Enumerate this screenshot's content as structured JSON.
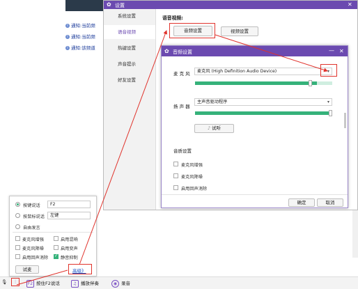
{
  "background": {
    "notices": [
      {
        "prefix": "通知:",
        "text": "当前频"
      },
      {
        "prefix": "通知:",
        "text": "当前频"
      },
      {
        "prefix": "通知:",
        "text": "该频道"
      }
    ]
  },
  "bottom_bar": {
    "hold_f2": "按住F2说话",
    "play_music": "播放伴奏",
    "record": "录音"
  },
  "settings": {
    "title": "设置",
    "sidebar": [
      "系统设置",
      "语音视频",
      "热键设置",
      "声音提示",
      "好友设置"
    ],
    "active_index": 1,
    "section_label": "语音视频:",
    "audio_button": "音频设置",
    "video_button": "视频设置"
  },
  "audio_dialog": {
    "title": "音频设置",
    "mic_label": "麦 克 风",
    "mic_device": "麦克风 (High Definition Audio Device)",
    "mic_level": 0.89,
    "speaker_label": "扬 声 器",
    "speaker_device": "主声音驱动程序",
    "speaker_level": 1.0,
    "test_button": "试听",
    "quality_label": "音质设置",
    "options": [
      "麦克风增强",
      "麦克风降噪",
      "启用回声消除"
    ],
    "ok": "确定",
    "cancel": "取消"
  },
  "popup": {
    "radio_options": [
      "按键说话",
      "按鼠标说话",
      "自由发言"
    ],
    "selected_radio": 0,
    "key_value": "F2",
    "mouse_value": "左键",
    "checks": [
      {
        "label": "麦克风增强",
        "checked": false
      },
      {
        "label": "启用混响",
        "checked": false
      },
      {
        "label": "麦克风降噪",
        "checked": false
      },
      {
        "label": "启用变声",
        "checked": false
      },
      {
        "label": "启用回声消除",
        "checked": false
      },
      {
        "label": "静音抑制",
        "checked": true
      }
    ],
    "test_button": "试麦",
    "advanced_link": "高级》"
  },
  "colors": {
    "accent": "#6b4ab0",
    "green": "#35b27a",
    "highlight": "#e0332c"
  }
}
